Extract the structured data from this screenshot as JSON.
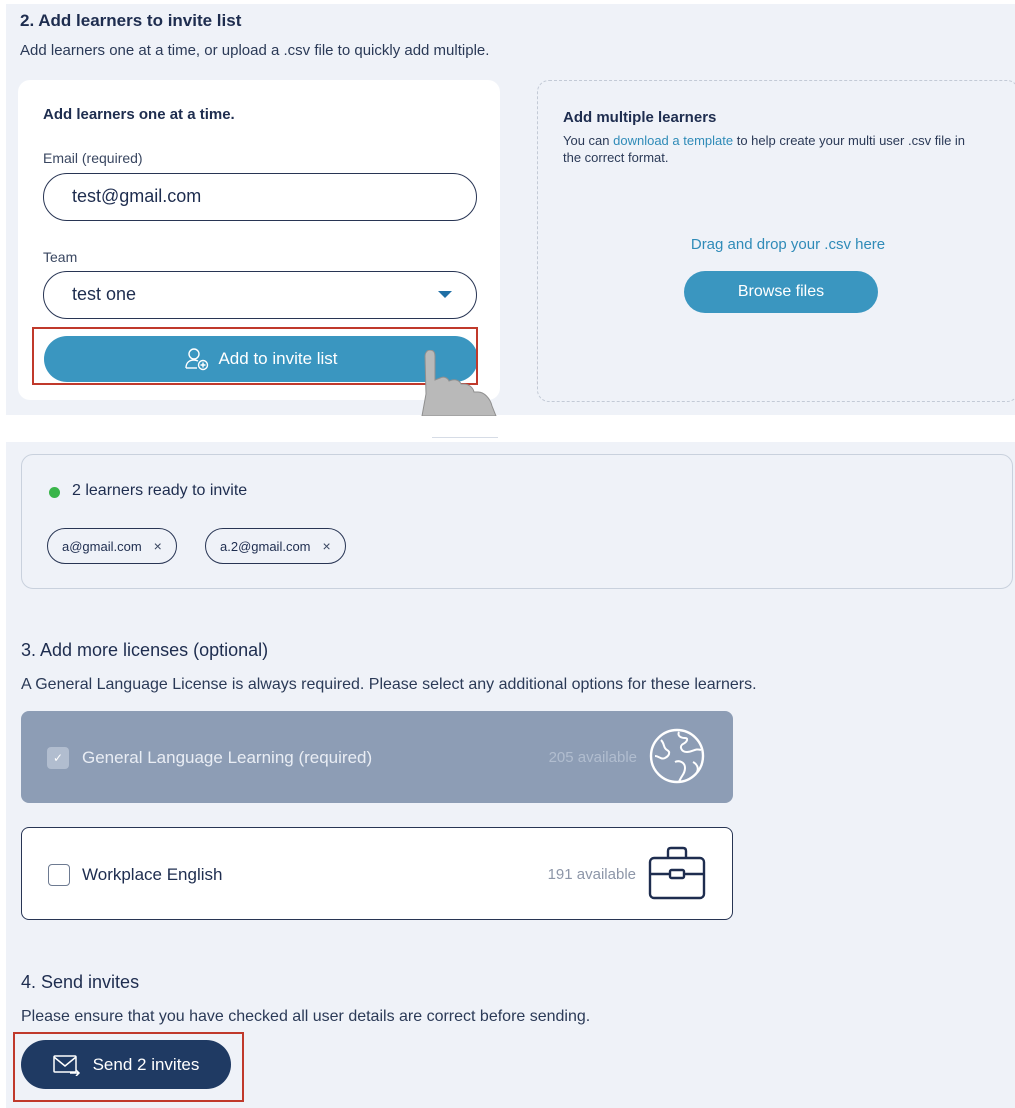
{
  "section2": {
    "title": "2. Add learners to invite list",
    "subtitle": "Add learners one at a time, or upload a .csv file to quickly add multiple.",
    "single": {
      "title": "Add learners one at a time.",
      "email_label": "Email (required)",
      "email_value": "test@gmail.com",
      "team_label": "Team",
      "team_value": "test one",
      "add_button": "Add to invite list"
    },
    "multiple": {
      "title": "Add multiple learners",
      "desc_prefix": "You can ",
      "desc_link": "download a template",
      "desc_suffix": " to help create your multi user .csv file in the correct format.",
      "drag_text": "Drag and drop your .csv here",
      "browse_button": "Browse files"
    }
  },
  "ready": {
    "text": "2 learners ready to invite",
    "chips": [
      "a@gmail.com",
      "a.2@gmail.com"
    ],
    "remove_glyph": "×"
  },
  "section3": {
    "title": "3. Add more licenses (optional)",
    "subtitle": "A General Language License is always required. Please select any additional options for these learners.",
    "licenses": [
      {
        "name": "General Language Learning (required)",
        "available": "205 available",
        "checked": true,
        "disabled": true,
        "icon": "globe-icon"
      },
      {
        "name": "Workplace English",
        "available": "191 available",
        "checked": false,
        "disabled": false,
        "icon": "briefcase-icon"
      }
    ]
  },
  "section4": {
    "title": "4. Send invites",
    "subtitle": "Please ensure that you have checked all user details are correct before sending.",
    "send_button": "Send 2 invites"
  },
  "colors": {
    "primary_button": "#3a96c0",
    "navy_button": "#1f3a63",
    "highlight": "#c0392b",
    "status_dot": "#39b54a",
    "link": "#2f8bb8"
  }
}
